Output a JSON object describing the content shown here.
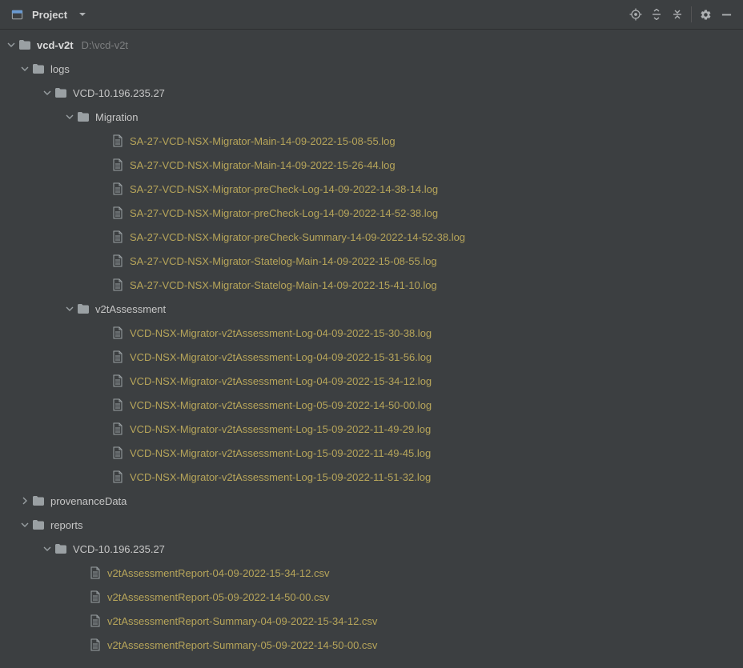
{
  "toolbar": {
    "title": "Project"
  },
  "root": {
    "name": "vcd-v2t",
    "path": "D:\\vcd-v2t"
  },
  "logs": {
    "label": "logs",
    "vcd": {
      "label": "VCD-10.196.235.27",
      "migration": {
        "label": "Migration",
        "files": [
          "SA-27-VCD-NSX-Migrator-Main-14-09-2022-15-08-55.log",
          "SA-27-VCD-NSX-Migrator-Main-14-09-2022-15-26-44.log",
          "SA-27-VCD-NSX-Migrator-preCheck-Log-14-09-2022-14-38-14.log",
          "SA-27-VCD-NSX-Migrator-preCheck-Log-14-09-2022-14-52-38.log",
          "SA-27-VCD-NSX-Migrator-preCheck-Summary-14-09-2022-14-52-38.log",
          "SA-27-VCD-NSX-Migrator-Statelog-Main-14-09-2022-15-08-55.log",
          "SA-27-VCD-NSX-Migrator-Statelog-Main-14-09-2022-15-41-10.log"
        ]
      },
      "v2t": {
        "label": "v2tAssessment",
        "files": [
          "VCD-NSX-Migrator-v2tAssessment-Log-04-09-2022-15-30-38.log",
          "VCD-NSX-Migrator-v2tAssessment-Log-04-09-2022-15-31-56.log",
          "VCD-NSX-Migrator-v2tAssessment-Log-04-09-2022-15-34-12.log",
          "VCD-NSX-Migrator-v2tAssessment-Log-05-09-2022-14-50-00.log",
          "VCD-NSX-Migrator-v2tAssessment-Log-15-09-2022-11-49-29.log",
          "VCD-NSX-Migrator-v2tAssessment-Log-15-09-2022-11-49-45.log",
          "VCD-NSX-Migrator-v2tAssessment-Log-15-09-2022-11-51-32.log"
        ]
      }
    }
  },
  "provenance": {
    "label": "provenanceData"
  },
  "reports": {
    "label": "reports",
    "vcd": {
      "label": "VCD-10.196.235.27",
      "files": [
        "v2tAssessmentReport-04-09-2022-15-34-12.csv",
        "v2tAssessmentReport-05-09-2022-14-50-00.csv",
        "v2tAssessmentReport-Summary-04-09-2022-15-34-12.csv",
        "v2tAssessmentReport-Summary-05-09-2022-14-50-00.csv"
      ]
    }
  }
}
